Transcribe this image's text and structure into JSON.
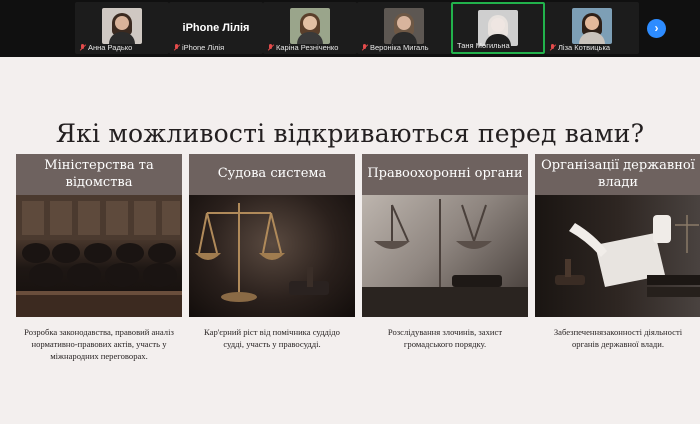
{
  "participants": [
    {
      "name": "Анна Радько",
      "type": "video",
      "skin": "#d9b39a",
      "hair": "#3b2a20",
      "bg": "#cfc8c2",
      "active": false
    },
    {
      "name": "iPhone Лілія",
      "type": "name",
      "big": "iPhone Лілія",
      "active": false
    },
    {
      "name": "Каріна Резніченко",
      "type": "video",
      "skin": "#e2c0a4",
      "hair": "#5a3f2b",
      "bg": "#9aa58b",
      "active": false
    },
    {
      "name": "Вероніка Мигаль",
      "type": "video",
      "skin": "#d8b49d",
      "hair": "#6e5845",
      "bg": "#5d5752",
      "active": false
    },
    {
      "name": "Таня Могильна",
      "type": "video",
      "skin": "#efe6e2",
      "hair": "#e9e3df",
      "bg": "#cfcfcf",
      "active": true
    },
    {
      "name": "Ліза Котвицька",
      "type": "video",
      "skin": "#e3b99b",
      "hair": "#2e2018",
      "bg": "#7d9fb6",
      "active": false
    }
  ],
  "slide": {
    "title": "Які можливості відкриваються перед вами?",
    "cards": [
      {
        "heading": "Міністерства та відомства",
        "text": "Розробка законодавства, правовий аналіз нормативно-правових актів, участь у міжнародних переговорах.",
        "image": "courtroom-chairs"
      },
      {
        "heading": "Судова система",
        "text": "Кар'єрний ріст від помічника суддідо судді, участь у правосудді.",
        "image": "scales-of-justice"
      },
      {
        "heading": "Правоохоронні органи",
        "text": "Розслідування злочинів, захист громадського порядку.",
        "image": "scales-and-gavel"
      },
      {
        "heading": "Організації державної влади",
        "text": "Забезпеченнязаконності діяльності органів державної влади.",
        "image": "signing-documents"
      }
    ]
  },
  "icons": {
    "mic_muted": "mic-muted-icon",
    "next": "chevron-right-icon"
  },
  "colors": {
    "active_border": "#22b24c",
    "card_header": "#6e625f",
    "next_button": "#2d8cff",
    "slide_bg": "#f3efee"
  }
}
